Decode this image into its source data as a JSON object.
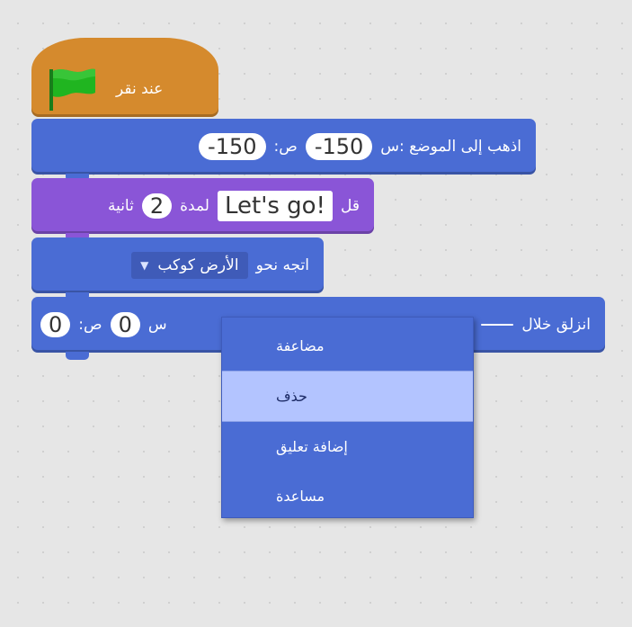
{
  "blocks": {
    "when_flag": {
      "label": "عند نقر"
    },
    "go_to": {
      "label": "اذهب إلى الموضع :س",
      "y_label": ":ص",
      "x_value": "-150",
      "y_value": "-150"
    },
    "say": {
      "label": "قل",
      "text": "Let's go!",
      "for_label": "لمدة",
      "secs": "2",
      "secs_label": "ثانية"
    },
    "point_towards": {
      "label": "اتجه نحو",
      "target": "الأرض كوكب"
    },
    "glide": {
      "label": "انزلق خلال",
      "x_label": "س",
      "y_label": ":ص",
      "x_value": "0",
      "y_value": "0"
    }
  },
  "context_menu": {
    "items": [
      {
        "label": "مضاعفة"
      },
      {
        "label": "حذف"
      },
      {
        "label": "إضافة تعليق"
      },
      {
        "label": "مساعدة"
      }
    ]
  },
  "colors": {
    "motion": "#4a6cd4",
    "looks": "#8a55d7",
    "events": "#d58a2d",
    "flag": "#1fae1f"
  },
  "icons": {
    "flag": "green-flag-icon",
    "dropdown": "caret-down-icon"
  }
}
